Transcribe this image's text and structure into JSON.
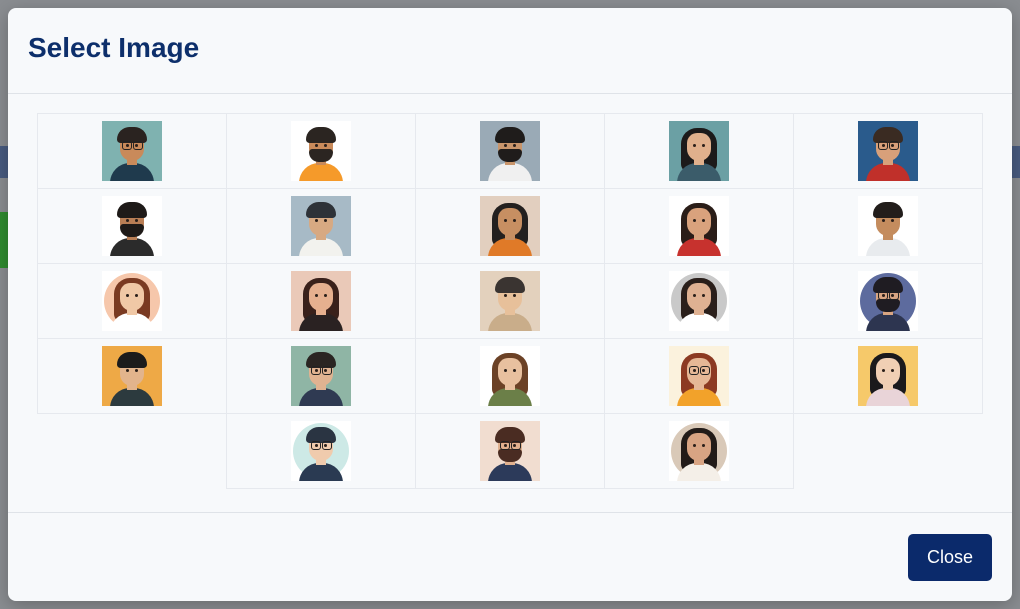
{
  "modal": {
    "title": "Select Image",
    "close_label": "Close"
  },
  "accent_color": "#0b2a6b",
  "images": [
    {
      "name": "avatar-man-glasses-teal",
      "bg": "#7fb2b0",
      "skin": "#c98a5a",
      "hair": "#2a2320",
      "shirt": "#1f3a4d",
      "glasses": true,
      "beard": false,
      "long": false
    },
    {
      "name": "avatar-man-beard-orange",
      "bg": "#ffffff",
      "skin": "#c98a5a",
      "hair": "#2b2521",
      "shirt": "#f59a2a",
      "glasses": false,
      "beard": true,
      "long": false
    },
    {
      "name": "avatar-man-beard-white-shirt",
      "bg": "#9aaab6",
      "skin": "#c9956b",
      "hair": "#1f1c1b",
      "shirt": "#f0f0f0",
      "glasses": false,
      "beard": true,
      "long": false
    },
    {
      "name": "avatar-woman-dark-hair-teal",
      "bg": "#6ba0a4",
      "skin": "#e0b08c",
      "hair": "#1c1a1a",
      "shirt": "#3b5c6a",
      "glasses": false,
      "beard": false,
      "long": true
    },
    {
      "name": "avatar-man-glasses-blue",
      "bg": "#2a5b8c",
      "skin": "#d8a07a",
      "hair": "#3a2b22",
      "shirt": "#c0302a",
      "glasses": true,
      "beard": false,
      "long": false
    },
    {
      "name": "avatar-man-beard-black-shirt",
      "bg": "#ffffff",
      "skin": "#b97e55",
      "hair": "#1e1a18",
      "shirt": "#2b2b2b",
      "glasses": false,
      "beard": true,
      "long": false
    },
    {
      "name": "avatar-man-white-shirt-grey",
      "bg": "#a7bac6",
      "skin": "#d7a982",
      "hair": "#2e3238",
      "shirt": "#f2f2ee",
      "glasses": false,
      "beard": false,
      "long": false
    },
    {
      "name": "avatar-woman-orange-top",
      "bg": "#e2cfbf",
      "skin": "#c78f62",
      "hair": "#23201f",
      "shirt": "#e07a28",
      "glasses": false,
      "beard": false,
      "long": true
    },
    {
      "name": "avatar-woman-red-top",
      "bg": "#ffffff",
      "skin": "#d9a27d",
      "hair": "#2a1d18",
      "shirt": "#c7322e",
      "glasses": false,
      "beard": false,
      "long": true
    },
    {
      "name": "avatar-man-smiling-white-shirt",
      "bg": "#ffffff",
      "skin": "#c48c5e",
      "hair": "#221d1b",
      "shirt": "#e8ebee",
      "glasses": false,
      "beard": false,
      "long": false
    },
    {
      "name": "avatar-woman-curly-peach",
      "bg": "#f6c7ab",
      "skin": "#f0c8a6",
      "hair": "#7a3a22",
      "shirt": "#ffffff",
      "glasses": false,
      "beard": false,
      "long": true,
      "round": true
    },
    {
      "name": "avatar-woman-wavy-hair-pink",
      "bg": "#eac9b8",
      "skin": "#e6b08f",
      "hair": "#3a211b",
      "shirt": "#2a2222",
      "glasses": false,
      "beard": false,
      "long": true
    },
    {
      "name": "avatar-man-beige",
      "bg": "#e3d1bd",
      "skin": "#e7c09a",
      "hair": "#3a3431",
      "shirt": "#c9ad8a",
      "glasses": false,
      "beard": false,
      "long": false
    },
    {
      "name": "avatar-woman-grey-circle",
      "bg": "#c9c9c9",
      "skin": "#dfb192",
      "hair": "#2a1f1b",
      "shirt": "#ffffff",
      "glasses": false,
      "beard": false,
      "long": true,
      "round": true
    },
    {
      "name": "avatar-man-glasses-indigo-circle",
      "bg": "#5d6b9e",
      "skin": "#d8a582",
      "hair": "#1f1c22",
      "shirt": "#2d3550",
      "glasses": true,
      "beard": true,
      "long": false,
      "round": true
    },
    {
      "name": "avatar-man-mustard",
      "bg": "#eea946",
      "skin": "#e2b48c",
      "hair": "#1b1b1b",
      "shirt": "#2c3a3e",
      "glasses": false,
      "beard": false,
      "long": false
    },
    {
      "name": "avatar-man-glasses-green",
      "bg": "#8fb5a5",
      "skin": "#e0b391",
      "hair": "#2a2522",
      "shirt": "#2f3a52",
      "glasses": true,
      "beard": false,
      "long": false
    },
    {
      "name": "avatar-woman-long-brown-hair",
      "bg": "#ffffff",
      "skin": "#e8c09f",
      "hair": "#6b4126",
      "shirt": "#6b7f48",
      "glasses": false,
      "beard": false,
      "long": true
    },
    {
      "name": "avatar-woman-glasses-yellow-top",
      "bg": "#fbf2dd",
      "skin": "#e6b896",
      "hair": "#8c3a22",
      "shirt": "#f2a22a",
      "glasses": true,
      "beard": false,
      "long": true
    },
    {
      "name": "avatar-woman-black-hair-yellow",
      "bg": "#f6c96a",
      "skin": "#f0cfb4",
      "hair": "#1b1a1c",
      "shirt": "#e9d4d8",
      "glasses": false,
      "beard": false,
      "long": true
    },
    {
      "name": "avatar-man-glasses-mint-circle",
      "bg": "#cde9e6",
      "skin": "#f0cbad",
      "hair": "#2a3442",
      "shirt": "#2a3a52",
      "glasses": true,
      "beard": false,
      "long": false,
      "round": true
    },
    {
      "name": "avatar-man-glasses-beard-peach",
      "bg": "#f1ddd0",
      "skin": "#e0b08e",
      "hair": "#4a2c22",
      "shirt": "#2c3a5a",
      "glasses": true,
      "beard": true,
      "long": false
    },
    {
      "name": "avatar-woman-beige-circle",
      "bg": "#d9c9b8",
      "skin": "#d8a483",
      "hair": "#221b18",
      "shirt": "#f4efe8",
      "glasses": false,
      "beard": false,
      "long": true,
      "round": true
    }
  ]
}
